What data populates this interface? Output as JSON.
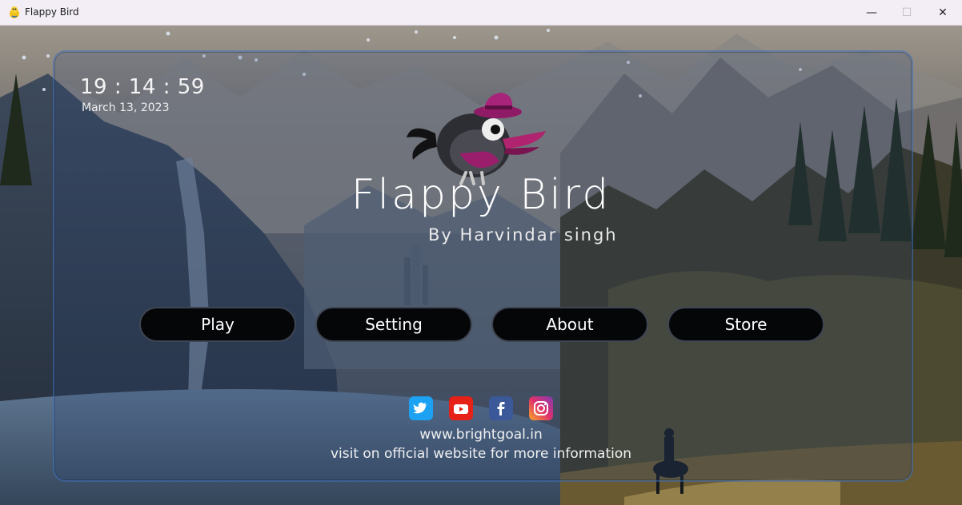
{
  "window": {
    "title": "Flappy Bird",
    "controls": {
      "minimize": "—",
      "maximize": "☐",
      "close": "✕"
    }
  },
  "clock": {
    "time": "19 : 14 : 59",
    "date": "March 13, 2023"
  },
  "game": {
    "title": "Flappy Bird",
    "byline": "By Harvindar singh"
  },
  "menu": {
    "play": "Play",
    "setting": "Setting",
    "about": "About",
    "store": "Store"
  },
  "social": [
    "twitter-icon",
    "youtube-icon",
    "facebook-icon",
    "instagram-icon"
  ],
  "footer": {
    "website": "www.brightgoal.in",
    "info": "visit on official website for more information"
  },
  "colors": {
    "twitter": "#1da1f2",
    "youtube": "#e62117",
    "facebook": "#3b5998",
    "instagram": "#c13584",
    "button_bg": "#050608",
    "panel_border": "#4678c8"
  }
}
